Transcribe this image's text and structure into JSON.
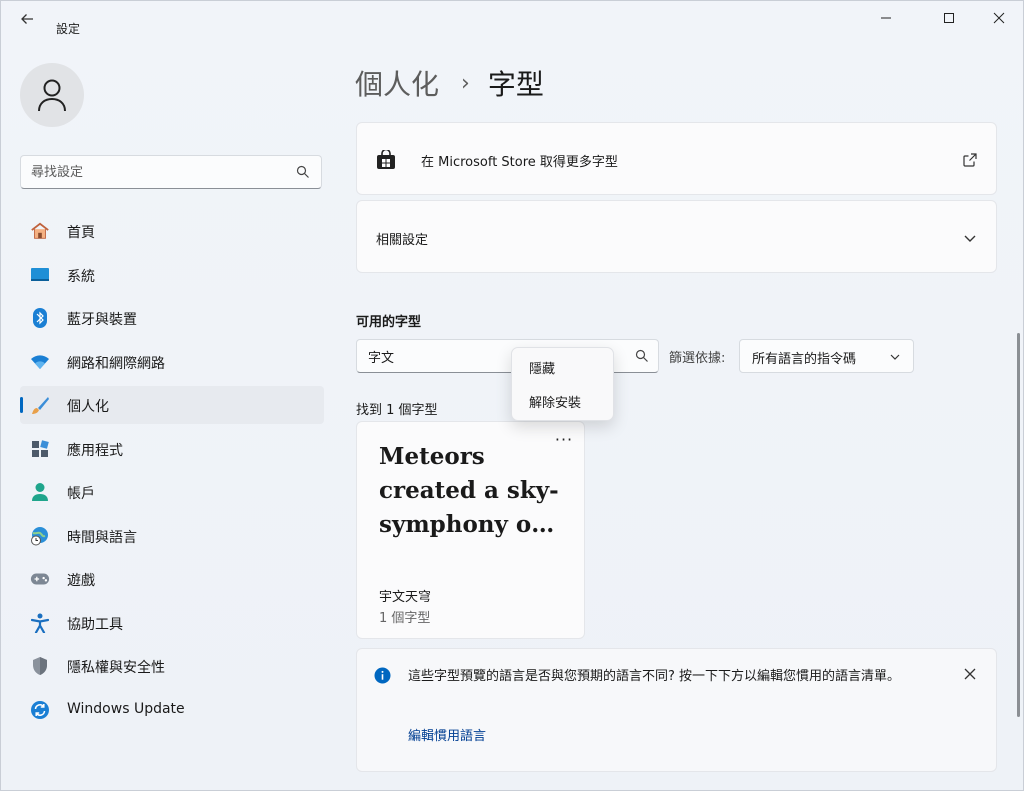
{
  "window": {
    "title": "設定",
    "controls": {
      "minimize": "—",
      "maximize": "☐",
      "close": "✕"
    }
  },
  "sidebar": {
    "search_placeholder": "尋找設定",
    "items": [
      {
        "label": "首頁",
        "icon": "home-icon"
      },
      {
        "label": "系統",
        "icon": "system-icon"
      },
      {
        "label": "藍牙與裝置",
        "icon": "bluetooth-icon"
      },
      {
        "label": "網路和網際網路",
        "icon": "wifi-icon"
      },
      {
        "label": "個人化",
        "icon": "brush-icon",
        "active": true
      },
      {
        "label": "應用程式",
        "icon": "apps-icon"
      },
      {
        "label": "帳戶",
        "icon": "account-icon"
      },
      {
        "label": "時間與語言",
        "icon": "globe-clock-icon"
      },
      {
        "label": "遊戲",
        "icon": "gamepad-icon"
      },
      {
        "label": "協助工具",
        "icon": "accessibility-icon"
      },
      {
        "label": "隱私權與安全性",
        "icon": "shield-icon"
      },
      {
        "label": "Windows Update",
        "icon": "update-icon"
      }
    ]
  },
  "breadcrumb": {
    "parent": "個人化",
    "separator": "›",
    "current": "字型"
  },
  "store_card": {
    "label": "在 Microsoft Store 取得更多字型"
  },
  "related_card": {
    "label": "相關設定"
  },
  "available_fonts": {
    "title": "可用的字型",
    "search_value": "字文",
    "filter_label": "篩選依據:",
    "filter_value": "所有語言的指令碼",
    "found_text": "找到 1 個字型",
    "font_card": {
      "preview": "Meteors created a sky-symphony o…",
      "more": "···",
      "name": "宇文天穹",
      "count": "1 個字型"
    }
  },
  "context_menu": {
    "hide": "隱藏",
    "uninstall": "解除安裝"
  },
  "info_bar": {
    "message": "這些字型預覽的語言是否與您預期的語言不同? 按一下下方以編輯您慣用的語言清單。",
    "link": "編輯慣用語言"
  },
  "colors": {
    "accent": "#0067c0",
    "link": "#003e92",
    "info": "#0067c0"
  }
}
